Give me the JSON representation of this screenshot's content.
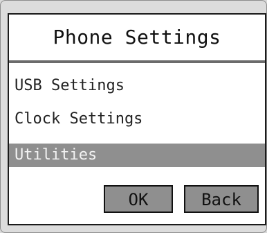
{
  "window": {
    "title": "Phone Settings"
  },
  "menu": {
    "items": [
      {
        "label": "USB Settings",
        "selected": false
      },
      {
        "label": "Clock Settings",
        "selected": false
      },
      {
        "label": "Utilities",
        "selected": true
      }
    ]
  },
  "buttons": {
    "ok_label": "OK",
    "back_label": "Back"
  },
  "colors": {
    "background": "#dcdcdc",
    "screen": "#ffffff",
    "selection": "#8f8f8f",
    "border": "#1a1a1a"
  }
}
